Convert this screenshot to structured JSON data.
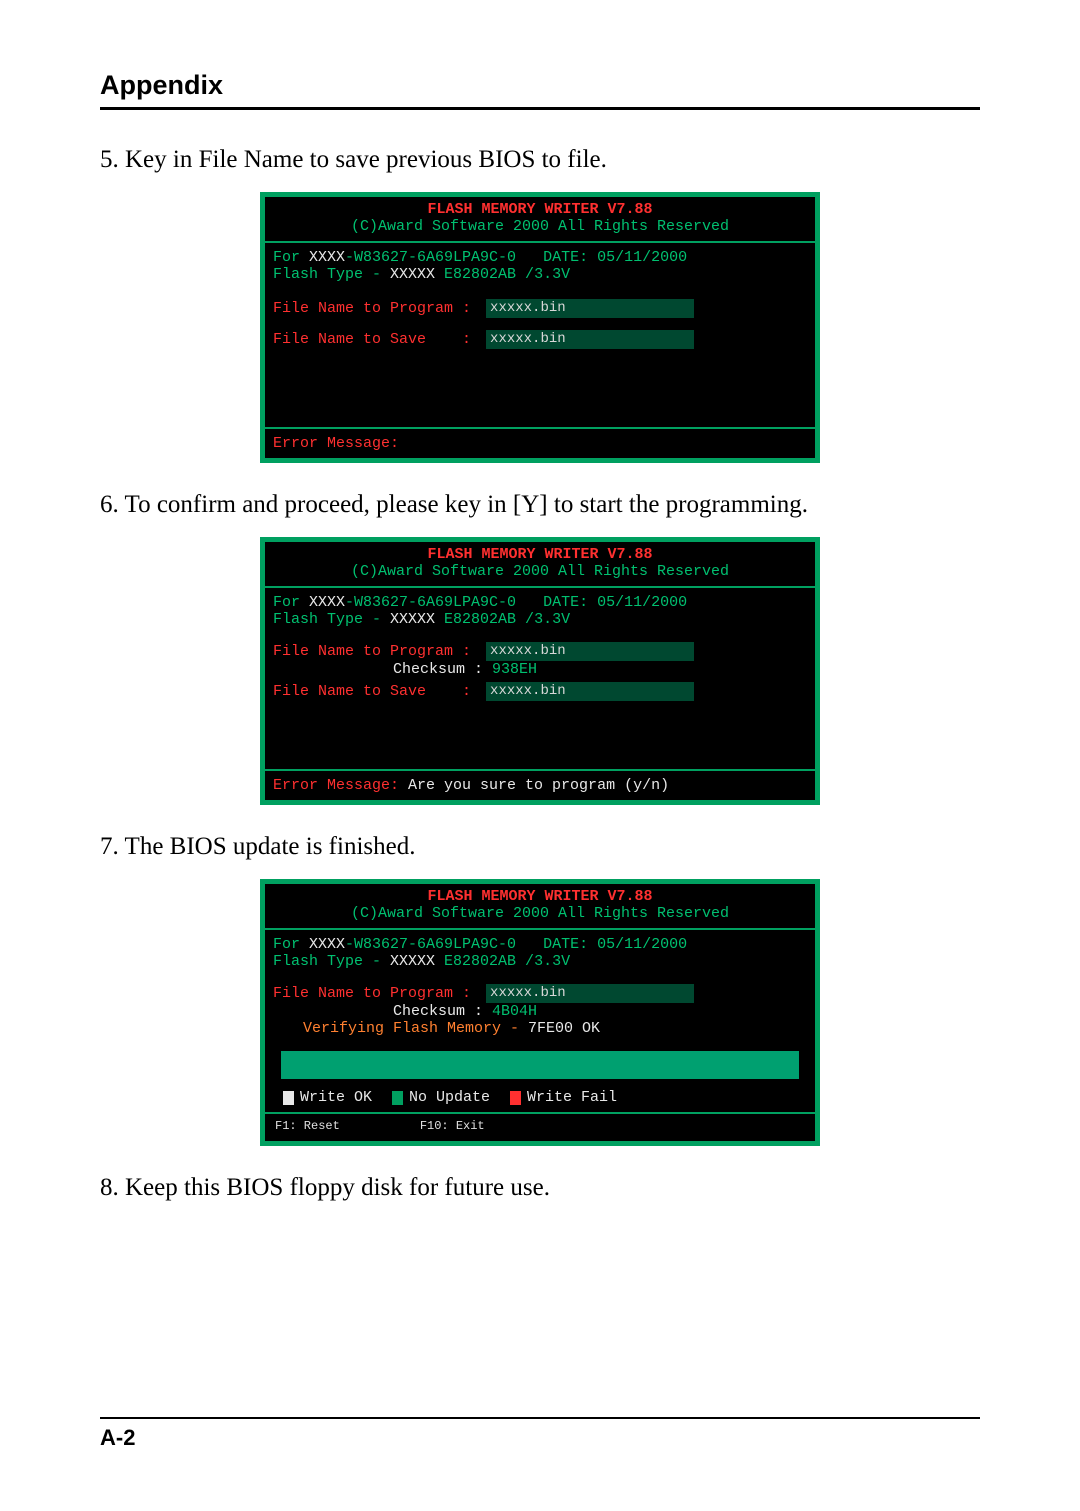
{
  "header": {
    "title": "Appendix"
  },
  "steps": {
    "s5": "5. Key in File Name to save previous BIOS to file.",
    "s6": "6. To confirm and proceed, please key in [Y] to start the programming.",
    "s7": "7. The BIOS update is finished.",
    "s8": "8. Keep this BIOS floppy disk for future use."
  },
  "common": {
    "title_line": "FLASH  MEMORY  WRITER V7.88",
    "copyright": "(C)Award Software 2000 All Rights Reserved",
    "for_prefix": "For ",
    "for_xxxx": "XXXX",
    "for_model": "-W83627-6A69LPA9C-0",
    "for_date": "   DATE: 05/11/2000",
    "flash_label": "Flash Type - ",
    "flash_xxxx": "XXXXX",
    "flash_value": " E82802AB /3.3V",
    "prog_label": "File Name to Program : ",
    "save_label": "File Name to Save    : ",
    "checksum_label": "Checksum : ",
    "file_value": "xxxxx.bin",
    "error_label": "Error Message:"
  },
  "screen5": {
    "error_value": ""
  },
  "screen6": {
    "checksum": "938EH",
    "error_value": "  Are you sure to program (y/n)"
  },
  "screen7": {
    "checksum": "4B04H",
    "verify_label": "Verifying Flash Memory - ",
    "verify_value": "7FE00 OK",
    "legend_ok": "Write OK",
    "legend_noupdate": "No Update",
    "legend_fail": "Write Fail",
    "key_f1": "F1: Reset",
    "key_f10": "F10: Exit"
  },
  "footer": {
    "page": "A-2"
  }
}
